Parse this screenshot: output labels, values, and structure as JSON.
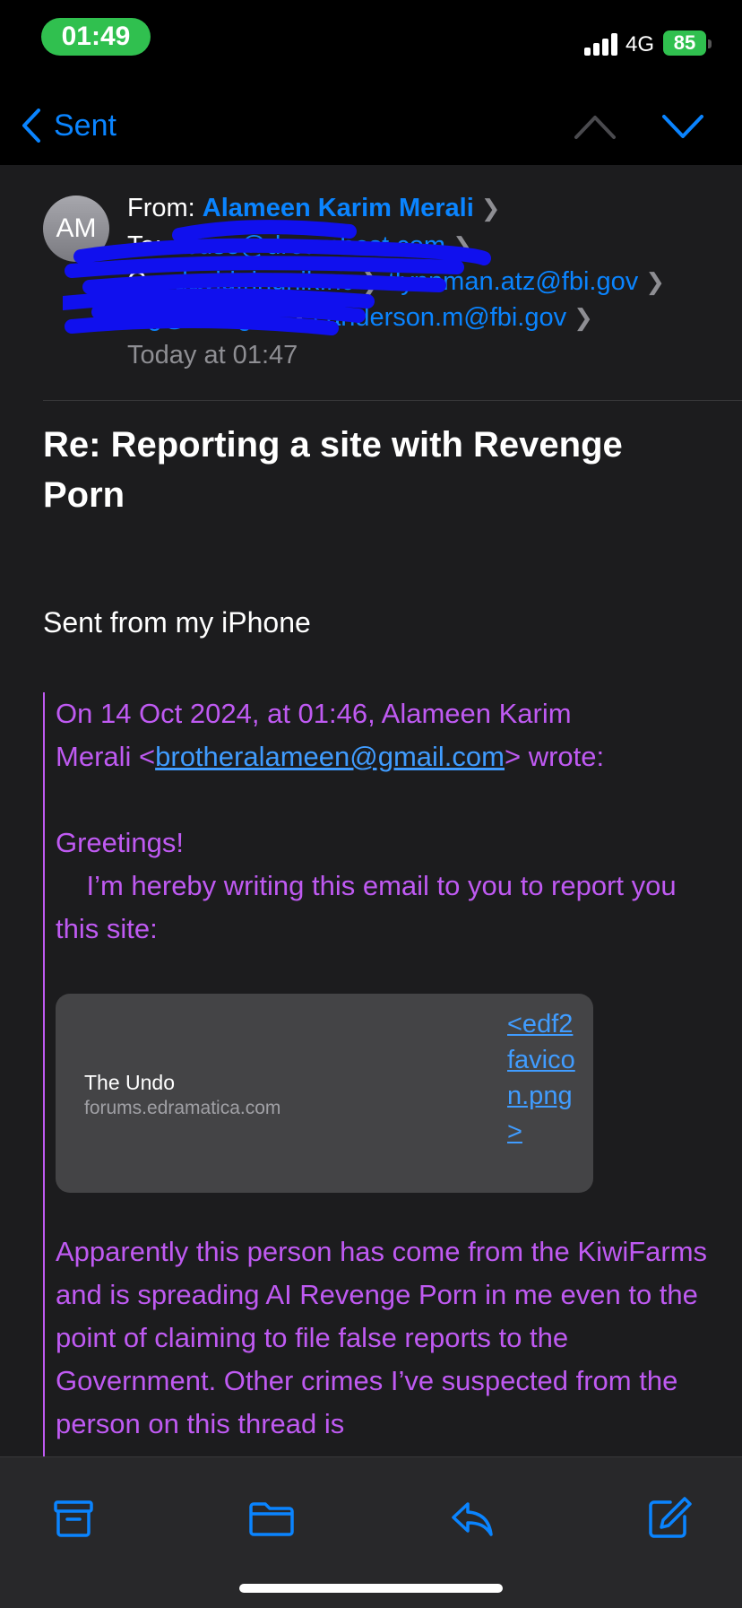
{
  "status_bar": {
    "time": "01:49",
    "network": "4G",
    "battery": "85"
  },
  "nav": {
    "back_label": "Sent"
  },
  "header": {
    "avatar_initials": "AM",
    "from_label": "From:",
    "from_name": "Alameen Karim Merali",
    "to_label": "To:",
    "to_value": "abuse@dreamhost.com",
    "cc_label": "Cc:",
    "cc_line1_a": "david.ringnik.nc",
    "cc_line1_b": "tlynnman.atz@fbi.gov",
    "cc_line2_a": "oig@doc.gov",
    "cc_line2_b": "canderson.m@fbi.gov",
    "date": "Today at 01:47"
  },
  "subject": "Re: Reporting a site with Revenge Porn",
  "body": {
    "sent_from": "Sent from my iPhone",
    "quote_intro_1": "On 14 Oct 2024, at 01:46, Alameen Karim",
    "quote_intro_2a": "Merali <",
    "quote_email": "brotheralameen@gmail.com",
    "quote_intro_2b": "> wrote:",
    "greeting": "Greetings!",
    "para1": "    I’m hereby writing this email to you to report you this site:",
    "link_card": {
      "title": "The Undo",
      "domain": "forums.edramatica.com",
      "image_link": "<edf2favicon.png>"
    },
    "para2": "Apparently this person has come from the KiwiFarms and is spreading AI Revenge Porn in me even to the point of claiming to file false reports to the Government. Other crimes I’ve suspected from the person on this thread is"
  },
  "toolbar": {
    "icons": [
      "archive-icon",
      "folder-icon",
      "reply-icon",
      "compose-icon"
    ]
  },
  "colors": {
    "accent": "#0a84ff",
    "quote": "#bf5af2",
    "status_green": "#30c04f",
    "redaction": "#1010ee"
  }
}
